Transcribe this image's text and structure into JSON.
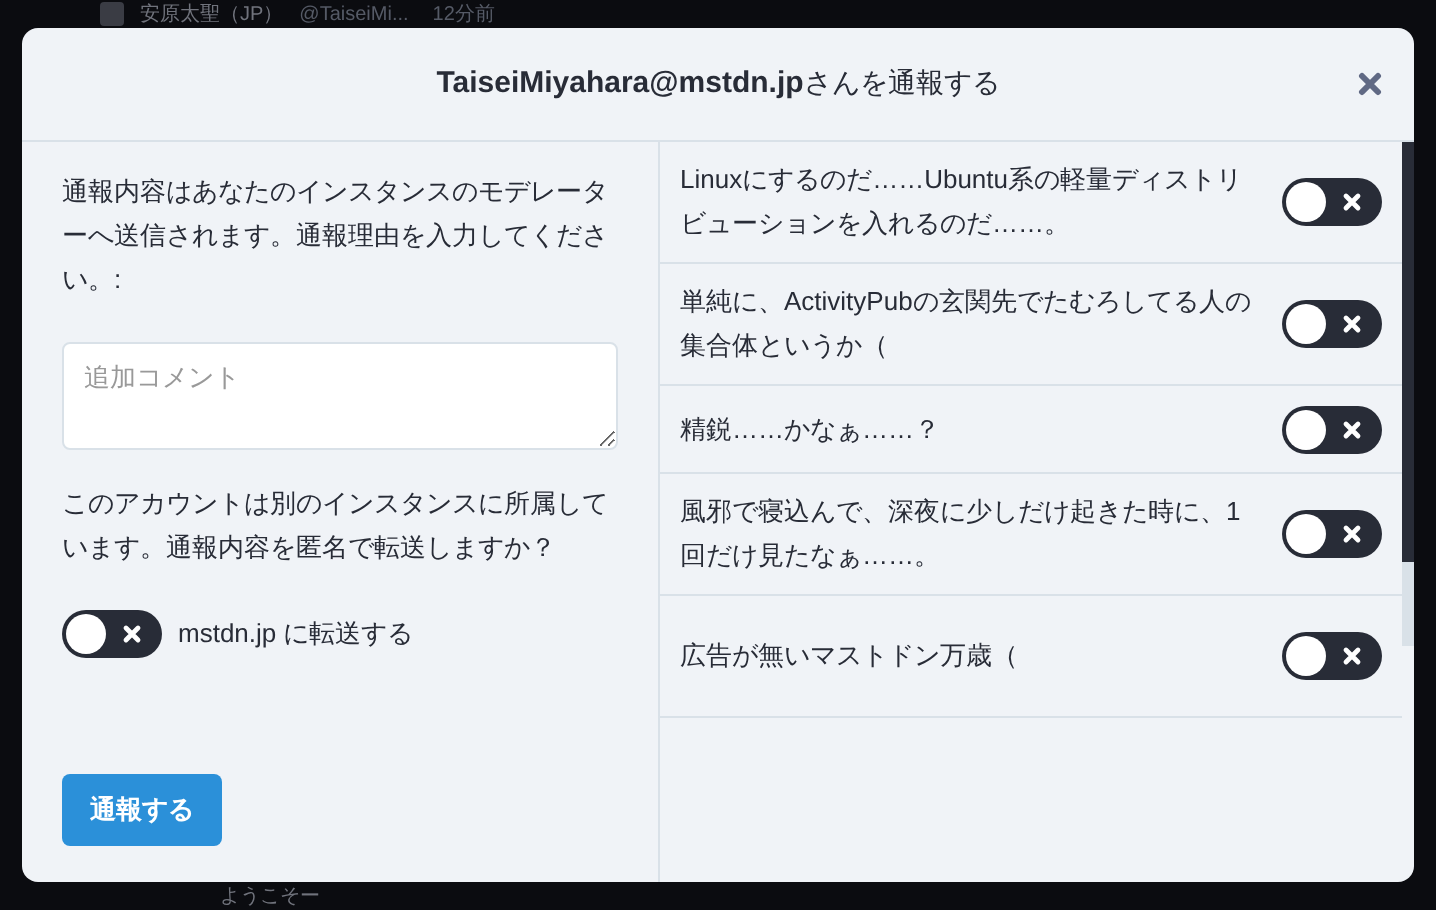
{
  "background": {
    "author_name": "安原太聖（JP）",
    "author_handle": "@TaiseiMi...",
    "time": "12分前",
    "post_text": "ようこそー"
  },
  "modal": {
    "title_account": "TaiseiMiyahara@mstdn.jp",
    "title_suffix": "さんを通報する"
  },
  "left": {
    "intro": "通報内容はあなたのインスタンスのモデレーターへ送信されます。通報理由を入力してください。:",
    "comment": {
      "placeholder": "追加コメント"
    },
    "forward_question": "このアカウントは別のインスタンスに所属しています。通報内容を匿名で転送しますか？",
    "forward_toggle": {
      "label": "mstdn.jp に転送する",
      "checked": false
    },
    "submit": "通報する"
  },
  "statuses": [
    {
      "text": "Linuxにするのだ……Ubuntu系の軽量ディストリビューションを入れるのだ……。",
      "checked": false
    },
    {
      "text": "単純に、ActivityPubの玄関先でたむろしてる人の集合体というか（",
      "checked": false
    },
    {
      "text": "精鋭……かなぁ……？",
      "checked": false
    },
    {
      "text": "風邪で寝込んで、深夜に少しだけ起きた時に、1回だけ見たなぁ……。",
      "checked": false
    },
    {
      "text": "広告が無いマストドン万歳（",
      "checked": false
    }
  ]
}
